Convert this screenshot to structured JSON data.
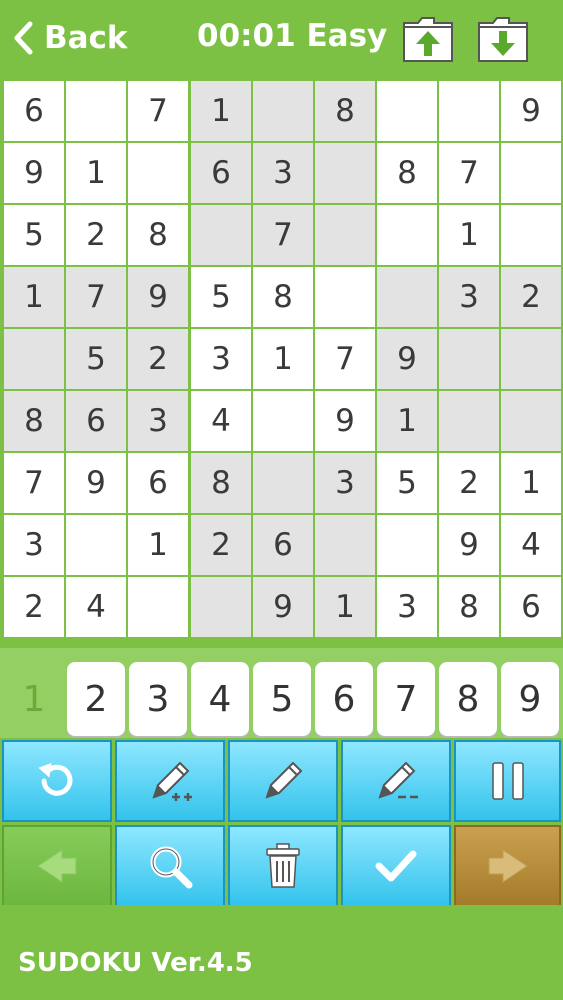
{
  "header": {
    "back_label": "Back",
    "timer": "00:01",
    "difficulty": "Easy"
  },
  "board": [
    [
      "6",
      "",
      "7",
      "1",
      "",
      "8",
      "",
      "",
      "9"
    ],
    [
      "9",
      "1",
      "",
      "6",
      "3",
      "",
      "8",
      "7",
      ""
    ],
    [
      "5",
      "2",
      "8",
      "",
      "7",
      "",
      "",
      "1",
      ""
    ],
    [
      "1",
      "7",
      "9",
      "5",
      "8",
      "",
      "",
      "3",
      "2"
    ],
    [
      "",
      "5",
      "2",
      "3",
      "1",
      "7",
      "9",
      "",
      ""
    ],
    [
      "8",
      "6",
      "3",
      "4",
      "",
      "9",
      "1",
      "",
      ""
    ],
    [
      "7",
      "9",
      "6",
      "8",
      "",
      "3",
      "5",
      "2",
      "1"
    ],
    [
      "3",
      "",
      "1",
      "2",
      "6",
      "",
      "",
      "9",
      "4"
    ],
    [
      "2",
      "4",
      "",
      "",
      "9",
      "1",
      "3",
      "8",
      "6"
    ]
  ],
  "digits": [
    "1",
    "2",
    "3",
    "4",
    "5",
    "6",
    "7",
    "8",
    "9"
  ],
  "digit_used": [
    true,
    false,
    false,
    false,
    false,
    false,
    false,
    false,
    false
  ],
  "tools_row1": [
    "restart-icon",
    "pencil-plus-icon",
    "pencil-icon",
    "pencil-minus-icon",
    "pause-icon"
  ],
  "tools_row2": [
    "arrow-left-icon",
    "magnifier-icon",
    "trash-icon",
    "checkmark-icon",
    "arrow-right-icon"
  ],
  "footer": {
    "version": "SUDOKU Ver.4.5"
  },
  "colors": {
    "background": "#7cc144",
    "shaded_cell": "#e3e3e3",
    "tool_blue": "#34c3ec",
    "nav_green": "#6cb73f",
    "nav_brown": "#a47b2a"
  }
}
